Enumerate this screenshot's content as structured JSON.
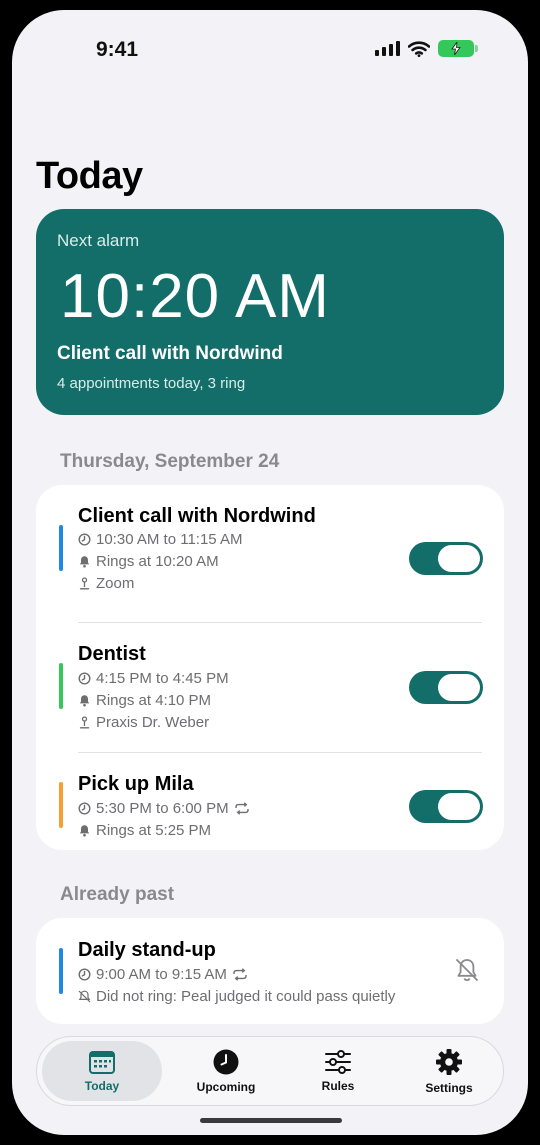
{
  "status_bar": {
    "time": "9:41"
  },
  "page": {
    "title": "Today"
  },
  "next_alarm": {
    "label": "Next alarm",
    "time": "10:20 AM",
    "title": "Client call with Nordwind",
    "summary": "4 appointments today, 3 ring"
  },
  "sections": {
    "today": "Thursday, September 24",
    "past": "Already past"
  },
  "appointments": [
    {
      "title": "Client call with Nordwind",
      "time": "10:30 AM to 11:15 AM",
      "ring": "Rings at 10:20 AM",
      "location": "Zoom",
      "accent": "#1e88e5",
      "enabled": true
    },
    {
      "title": "Dentist",
      "time": "4:15 PM to 4:45 PM",
      "ring": "Rings at 4:10 PM",
      "location": "Praxis Dr. Weber",
      "accent": "#34c759",
      "enabled": true
    },
    {
      "title": "Pick up Mila",
      "time": "5:30 PM to 6:00 PM",
      "ring": "Rings at 5:25 PM",
      "accent": "#f5a030",
      "repeats": true,
      "enabled": true
    }
  ],
  "past_appointments": [
    {
      "title": "Daily stand-up",
      "time": "9:00 AM to 9:15 AM",
      "note": "Did not ring: Peal judged it could pass quietly",
      "accent": "#1e88e5",
      "repeats": true,
      "status_icon": "bell-slash-icon"
    }
  ],
  "tabs": [
    {
      "label": "Today",
      "icon": "calendar-icon",
      "active": true
    },
    {
      "label": "Upcoming",
      "icon": "clock-icon",
      "active": false
    },
    {
      "label": "Rules",
      "icon": "sliders-icon",
      "active": false
    },
    {
      "label": "Settings",
      "icon": "gear-icon",
      "active": false
    }
  ],
  "colors": {
    "accent": "#136e6a",
    "background": "#f2f2f7"
  }
}
